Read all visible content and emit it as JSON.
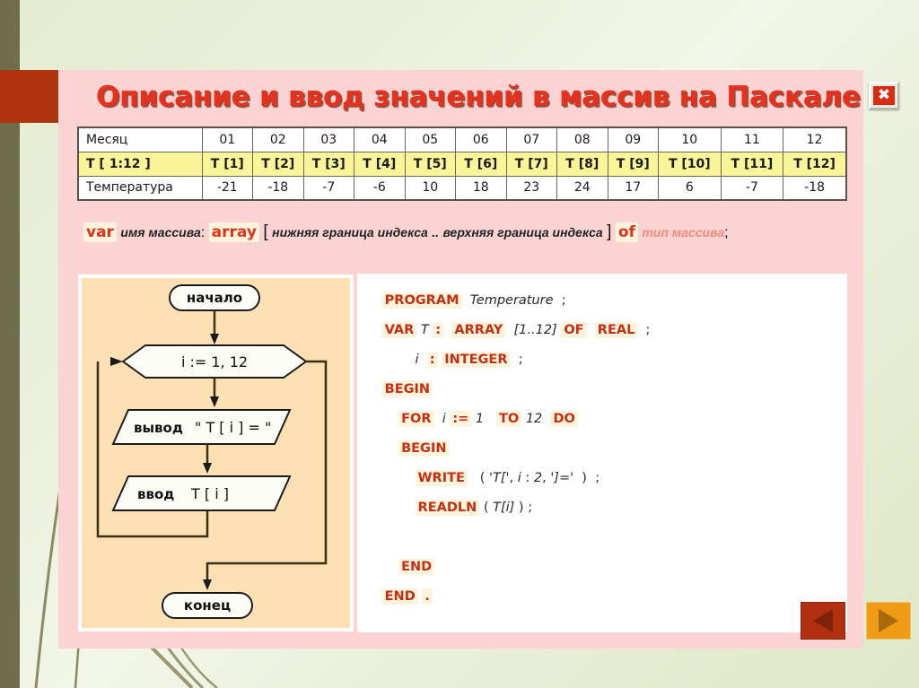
{
  "slide": {
    "title": "Описание и ввод значений в массив на Паскале",
    "close_icon_glyph": "✖"
  },
  "table": {
    "rows": [
      {
        "name": "month-row",
        "label": "Месяц",
        "cells": [
          "01",
          "02",
          "03",
          "04",
          "05",
          "06",
          "07",
          "08",
          "09",
          "10",
          "11",
          "12"
        ]
      },
      {
        "name": "array-row",
        "label": "T [ 1:12 ]",
        "cells": [
          "T [1]",
          "T [2]",
          "T [3]",
          "T [4]",
          "T [5]",
          "T [6]",
          "T [7]",
          "T [8]",
          "T [9]",
          "T [10]",
          "T [11]",
          "T [12]"
        ]
      },
      {
        "name": "temperature-row",
        "label": "Температура",
        "cells": [
          "-21",
          "-18",
          "-7",
          "-6",
          "10",
          "18",
          "23",
          "24",
          "17",
          "6",
          "-7",
          "-18"
        ]
      }
    ]
  },
  "syntax": {
    "var_kw": "var",
    "array_name": "имя массива",
    "colon": ":",
    "array_kw": "array",
    "bracket_open": "[",
    "lower_bound": "нижняя граница индекса",
    "range_dots": "..",
    "upper_bound": "верхняя граница индекса",
    "bracket_close": "]",
    "of_kw": "of",
    "array_type": "тип массива",
    "semicolon": ";"
  },
  "flowchart": {
    "start": "начало",
    "loop": "i := 1, 12",
    "output_kw": "вывод",
    "output_arg": "\" T [ i ] = \"",
    "input_kw": "ввод",
    "input_arg": "T [ i ]",
    "end": "конец"
  },
  "code": {
    "lines": [
      {
        "indent": 0,
        "tokens": [
          {
            "t": "kw",
            "v": "PROGRAM"
          },
          {
            "t": "sp",
            "v": "  "
          },
          {
            "t": "id",
            "v": "Temperature"
          },
          {
            "t": "sp",
            "v": "  "
          },
          {
            "t": "pl",
            "v": ";"
          }
        ]
      },
      {
        "indent": 0,
        "tokens": [
          {
            "t": "kw",
            "v": "VAR"
          },
          {
            "t": "sp",
            "v": " "
          },
          {
            "t": "id",
            "v": "T"
          },
          {
            "t": "sp",
            "v": " "
          },
          {
            "t": "kw",
            "v": ":"
          },
          {
            "t": "sp",
            "v": "  "
          },
          {
            "t": "kw",
            "v": "ARRAY"
          },
          {
            "t": "sp",
            "v": "  "
          },
          {
            "t": "num",
            "v": "[1..12]"
          },
          {
            "t": "sp",
            "v": " "
          },
          {
            "t": "kw",
            "v": "OF"
          },
          {
            "t": "sp",
            "v": "  "
          },
          {
            "t": "kw",
            "v": "REAL"
          },
          {
            "t": "sp",
            "v": "  "
          },
          {
            "t": "pl",
            "v": ";"
          }
        ]
      },
      {
        "indent": 2,
        "tokens": [
          {
            "t": "id",
            "v": "i"
          },
          {
            "t": "sp",
            "v": "  "
          },
          {
            "t": "kw",
            "v": ":"
          },
          {
            "t": "sp",
            "v": " "
          },
          {
            "t": "kw",
            "v": "INTEGER"
          },
          {
            "t": "sp",
            "v": "  "
          },
          {
            "t": "pl",
            "v": ";"
          }
        ]
      },
      {
        "indent": 0,
        "tokens": [
          {
            "t": "kw",
            "v": "BEGIN"
          }
        ]
      },
      {
        "indent": 1,
        "tokens": [
          {
            "t": "kw",
            "v": "FOR"
          },
          {
            "t": "sp",
            "v": "  "
          },
          {
            "t": "id",
            "v": "i"
          },
          {
            "t": "sp",
            "v": " "
          },
          {
            "t": "kw",
            "v": ":="
          },
          {
            "t": "sp",
            "v": " "
          },
          {
            "t": "num",
            "v": "1"
          },
          {
            "t": "sp",
            "v": "   "
          },
          {
            "t": "kw",
            "v": "TO"
          },
          {
            "t": "sp",
            "v": " "
          },
          {
            "t": "num",
            "v": "12"
          },
          {
            "t": "sp",
            "v": "  "
          },
          {
            "t": "kw",
            "v": "DO"
          }
        ]
      },
      {
        "indent": 1,
        "tokens": [
          {
            "t": "kw",
            "v": "BEGIN"
          }
        ]
      },
      {
        "indent": 2,
        "tokens": [
          {
            "t": "kw",
            "v": "WRITE"
          },
          {
            "t": "sp",
            "v": "   "
          },
          {
            "t": "pl",
            "v": "( "
          },
          {
            "t": "num",
            "v": "'T['"
          },
          {
            "t": "pl",
            "v": ", "
          },
          {
            "t": "id",
            "v": "i"
          },
          {
            "t": "pl",
            "v": " : "
          },
          {
            "t": "num",
            "v": "2"
          },
          {
            "t": "pl",
            "v": ", "
          },
          {
            "t": "num",
            "v": "']='"
          },
          {
            "t": "pl",
            "v": "  )"
          },
          {
            "t": "sp",
            "v": "  "
          },
          {
            "t": "pl",
            "v": ";"
          }
        ]
      },
      {
        "indent": 2,
        "tokens": [
          {
            "t": "kw",
            "v": "READLN"
          },
          {
            "t": "sp",
            "v": " "
          },
          {
            "t": "pl",
            "v": "( "
          },
          {
            "t": "id",
            "v": "T[i]"
          },
          {
            "t": "pl",
            "v": " ) ;"
          }
        ]
      },
      {
        "indent": 0,
        "tokens": []
      },
      {
        "indent": 1,
        "tokens": [
          {
            "t": "kw",
            "v": "END"
          }
        ]
      },
      {
        "indent": 0,
        "tokens": [
          {
            "t": "kw",
            "v": "END"
          },
          {
            "t": "sp",
            "v": " "
          },
          {
            "t": "kw",
            "v": "."
          }
        ]
      }
    ]
  },
  "nav": {
    "prev_label": "Назад",
    "next_label": "Вперёд"
  },
  "colors": {
    "title_red": "#e8301c",
    "slide_pink": "#fbd3d3",
    "highlight_yellow": "#fbf59a",
    "flow_peach": "#fde0b3",
    "keyword_red": "#c62f12",
    "nav_prev": "#b0300f",
    "nav_next": "#ef9b16",
    "olive": "#6f6d4c"
  }
}
